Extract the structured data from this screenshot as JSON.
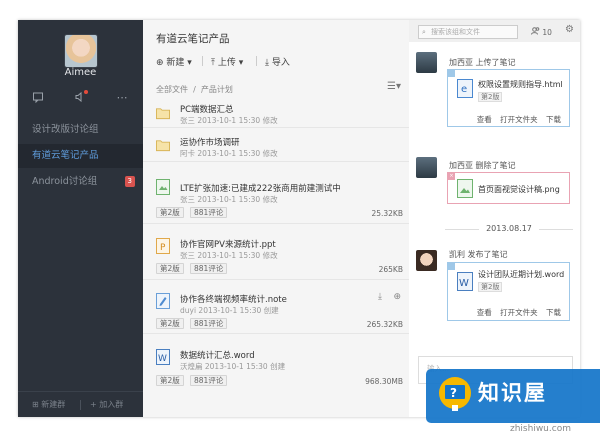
{
  "sidebar": {
    "username": "Aimee",
    "groups": [
      {
        "label": "设计改版讨论组",
        "active": false
      },
      {
        "label": "有道云笔记产品",
        "active": true
      },
      {
        "label": "Android讨论组",
        "active": false,
        "badge": "3"
      }
    ],
    "footer": {
      "new_group": "新建群",
      "join_group": "加入群"
    }
  },
  "main": {
    "title": "有道云笔记产品",
    "toolbar": {
      "new": "新建",
      "upload": "上传",
      "import": "导入"
    },
    "breadcrumb": {
      "root": "全部文件",
      "sep": "/",
      "current": "产品计划"
    },
    "rows": [
      {
        "type": "folder",
        "name": "PC端数据汇总",
        "meta": "张三  2013-10-1 15:30  修改"
      },
      {
        "type": "folder",
        "name": "运协作市场调研",
        "meta": "阿卡  2013-10-1 15:30  修改"
      },
      {
        "type": "image",
        "name": "LTE扩张加速:已建成222张商用前建测试中",
        "meta": "张三  2013-10-1 15:30  修改",
        "version": "第2版",
        "comments": "881评论",
        "size": "25.32KB"
      },
      {
        "type": "ppt",
        "name": "协作官网PV来源统计.ppt",
        "meta": "张三  2013-10-1 15:30  修改",
        "version": "第2版",
        "comments": "881评论",
        "size": "265KB"
      },
      {
        "type": "note",
        "name": "协作各终端视频率统计.note",
        "meta": "duyi  2013-10-1 15:30  创建",
        "version": "第2版",
        "comments": "881评论",
        "size": "265.32KB"
      },
      {
        "type": "word",
        "name": "数据统计汇总.word",
        "meta": "沃煌扁  2013-10-1 15:30  创建",
        "version": "第2版",
        "comments": "881评论",
        "size": "968.30MB"
      }
    ]
  },
  "panel": {
    "search_placeholder": "搜索该组和文件",
    "user_count": "10",
    "events": [
      {
        "actor_text": "加西亚 上传了笔记",
        "file": "权限设置规则指导.html",
        "version": "第2版",
        "actions": [
          "查看",
          "打开文件夹",
          "下载"
        ],
        "kind": "blue"
      },
      {
        "actor_text": "加西亚 删除了笔记",
        "file": "首页面视觉设计稿.png",
        "kind": "red"
      },
      {
        "actor_text": "凯利 发布了笔记",
        "file": "设计团队近期计划.word",
        "version": "第2版",
        "actions": [
          "查看",
          "打开文件夹",
          "下载"
        ],
        "kind": "blue"
      }
    ],
    "date_divider": "2013.08.17",
    "comment_placeholder": "输入..."
  },
  "watermark": {
    "brand": "知识屋",
    "url": "zhishiwu.com"
  },
  "colors": {
    "sidebar_bg": "#2c323b",
    "active_text": "#5f9cdb",
    "brand_blue": "#1475c9"
  }
}
